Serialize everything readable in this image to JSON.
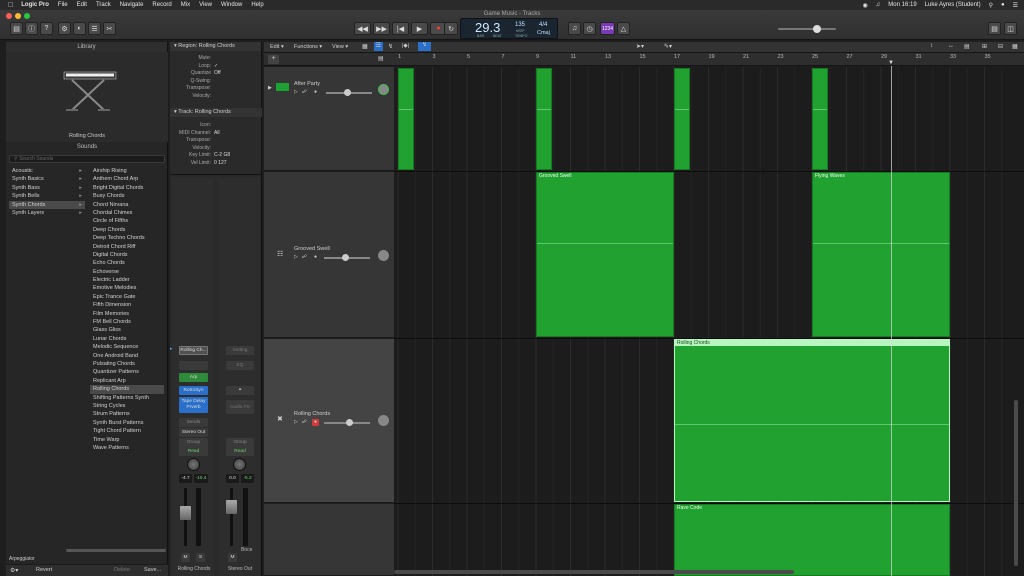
{
  "menubar": {
    "app": "Logic Pro",
    "items": [
      "File",
      "Edit",
      "Track",
      "Navigate",
      "Record",
      "Mix",
      "View",
      "Window",
      "Help"
    ],
    "clock": "Mon 16:19",
    "user": "Luke Ayres (Student)"
  },
  "window_title": "Game Music - Tracks",
  "lcd": {
    "bar": "29",
    "beat": "3",
    "bar_lbl": "BAR",
    "beat_lbl": "BEAT",
    "tempo": "135",
    "tempo_lbl": "KEEP",
    "tempo_sub": "TEMPO",
    "sig": "4/4",
    "key": "Cmaj",
    "count_in": "1234"
  },
  "library": {
    "title": "Library",
    "patch_name": "Rolling Chords",
    "sounds_label": "Sounds",
    "search_placeholder": "Search Sounds",
    "categories": [
      "Acoustic",
      "Synth Basics",
      "Synth Bass",
      "Synth Bells",
      "Synth Chords",
      "Synth Layers"
    ],
    "patches": [
      "Airship Rising",
      "Anthem Chord Arp",
      "Bright Digital Chords",
      "Busy Chords",
      "Chord Nirvana",
      "Chordal Chimes",
      "Circle of Fifths",
      "Deep Chords",
      "Deep Techno Chords",
      "Detroit Chord Riff",
      "Digital Chords",
      "Echo Chords",
      "Echoverse",
      "Electric Ladder",
      "Emotive Melodies",
      "Epic Trance Gate",
      "Fifth Dimension",
      "Film Memories",
      "FM Bell Chords",
      "Glass Gliss",
      "Lunar Chords",
      "Melodic Sequence",
      "One Android Band",
      "Pulsating Chords",
      "Quantizer Patterns",
      "Replicant Arp",
      "Rolling Chords",
      "Shifting Patterns Synth",
      "String Cycles",
      "Strum Patterns",
      "Synth Burst Patterns",
      "Tight Chord Pattern",
      "Time Warp",
      "Wave Patterns"
    ],
    "footer_label": "Arpeggiator",
    "revert": "Revert",
    "delete": "Delete",
    "save": "Save..."
  },
  "inspector": {
    "region_hdr": "Region: Rolling Chords",
    "region_rows": [
      {
        "k": "Mute:",
        "v": ""
      },
      {
        "k": "Loop:",
        "v": "✓"
      },
      {
        "k": "Quantize",
        "v": "Off"
      },
      {
        "k": "Q-Swing:",
        "v": ""
      },
      {
        "k": "Transpose:",
        "v": ""
      },
      {
        "k": "Velocity:",
        "v": ""
      }
    ],
    "track_hdr": "Track: Rolling Chords",
    "track_rows": [
      {
        "k": "Icon:",
        "v": ""
      },
      {
        "k": "MIDI Channel:",
        "v": "All"
      },
      {
        "k": "Transpose:",
        "v": ""
      },
      {
        "k": "Velocity:",
        "v": ""
      },
      {
        "k": "Key Limit:",
        "v": "C-2  G8"
      },
      {
        "k": "Vel Limit:",
        "v": "0  127"
      }
    ]
  },
  "strips": {
    "left": {
      "setting": "Rolling Ch...",
      "eq": "",
      "arp": "Arp",
      "fx1": "RetroSyn",
      "fx2": "Tape Delay",
      "fx3": "Prverb",
      "send": "Sends",
      "out": "Stereo Out",
      "group": "Group",
      "auto": "Read",
      "vol": "-4.7",
      "peak": "-10.4",
      "m": "M",
      "s": "S",
      "name": "Rolling Chords"
    },
    "right": {
      "setting": "Setting",
      "eq": "EQ",
      "fx": "Audio FX",
      "group": "Group",
      "auto": "Read",
      "vol": "0.0",
      "peak": "-5.2",
      "m": "M",
      "bnce": "Bnce",
      "name": "Stereo Out"
    }
  },
  "tracks_toolbar": {
    "edit": "Edit",
    "functions": "Functions",
    "view": "View"
  },
  "ruler": [
    "1",
    "3",
    "5",
    "7",
    "9",
    "11",
    "13",
    "15",
    "17",
    "19",
    "21",
    "23",
    "25",
    "27",
    "29",
    "31",
    "33",
    "35"
  ],
  "tracks": [
    {
      "name": "After Party"
    },
    {
      "name": "Grooved Swell"
    },
    {
      "name": "Rolling Chords"
    },
    {
      "name": ""
    }
  ],
  "regions": {
    "grooved_swell": "Grooved Swell",
    "flying_waves": "Flying Waves",
    "rolling_chords": "Rolling Chords",
    "rave_code": "Rave Code"
  }
}
